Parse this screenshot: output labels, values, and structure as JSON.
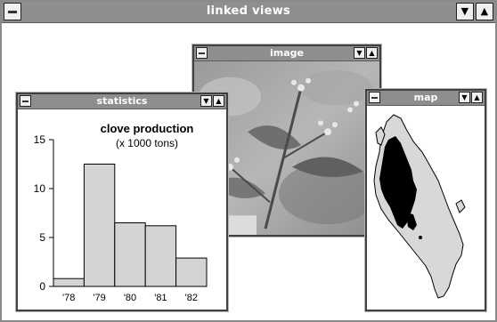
{
  "app": {
    "title": "linked views"
  },
  "windows": {
    "image": {
      "title": "image"
    },
    "statistics": {
      "title": "statistics"
    },
    "map": {
      "title": "map"
    }
  },
  "icons": {
    "system_menu": "system-menu-icon",
    "minimize": "minimize-arrow-icon",
    "maximize": "maximize-arrow-icon",
    "minimize_glyph": "▼",
    "maximize_glyph": "▲"
  },
  "chart_data": {
    "type": "bar",
    "title": "clove production",
    "subtitle": "(x 1000 tons)",
    "categories": [
      "'78",
      "'79",
      "'80",
      "'81",
      "'82"
    ],
    "values": [
      0.8,
      12.5,
      6.5,
      6.2,
      2.9
    ],
    "ylim": [
      0,
      15
    ],
    "yticks": [
      0,
      5,
      10,
      15
    ],
    "bar_color": "#d4d4d4",
    "grid": false
  },
  "colors": {
    "titlebar": "#8e8e8e",
    "land": "#d8d8d8",
    "region": "#000000"
  }
}
